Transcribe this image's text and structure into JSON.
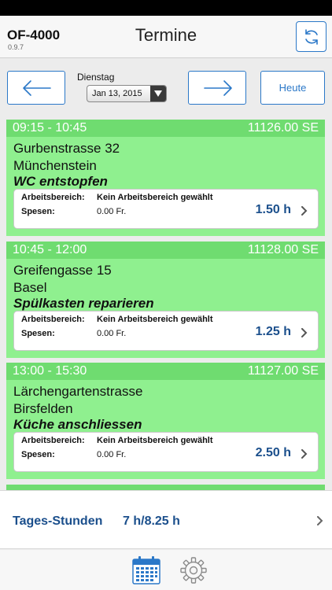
{
  "app": {
    "name": "OF-4000",
    "version": "0.9.7"
  },
  "nav": {
    "title": "Termine"
  },
  "datebar": {
    "day_label": "Dienstag",
    "date_value": "Jan 13, 2015",
    "today_label": "Heute"
  },
  "appointments": [
    {
      "time": "09:15 - 10:45",
      "number": "11126.00 SE",
      "street": "Gurbenstrasse 32",
      "city": "Münchenstein",
      "task": "WC entstopfen",
      "area_label": "Arbeitsbereich:",
      "area_value": "Kein Arbeitsbereich gewählt",
      "spesen_label": "Spesen:",
      "spesen_value": "0.00 Fr.",
      "hours": "1.50 h"
    },
    {
      "time": "10:45 - 12:00",
      "number": "11128.00 SE",
      "street": "Greifengasse 15",
      "city": "Basel",
      "task": "Spülkasten reparieren",
      "area_label": "Arbeitsbereich:",
      "area_value": "Kein Arbeitsbereich gewählt",
      "spesen_label": "Spesen:",
      "spesen_value": "0.00 Fr.",
      "hours": "1.25 h"
    },
    {
      "time": "13:00 - 15:30",
      "number": "11127.00 SE",
      "street": "Lärchengartenstrasse",
      "city": "Birsfelden",
      "task": "Küche anschliessen",
      "area_label": "Arbeitsbereich:",
      "area_value": "Kein Arbeitsbereich gewählt",
      "spesen_label": "Spesen:",
      "spesen_value": "0.00 Fr.",
      "hours": "2.50 h"
    }
  ],
  "totals": {
    "label": "Tages-Stunden",
    "value": "7 h/8.25 h"
  },
  "icons": {
    "sync": "sync-icon",
    "prev": "arrow-left-icon",
    "next": "arrow-right-icon",
    "dropdown": "triangle-down-icon",
    "chevron": "chevron-right-icon",
    "calendar": "calendar-icon",
    "settings": "gear-icon"
  },
  "colors": {
    "accent": "#2b78c8",
    "card": "#8ff08f",
    "card_header": "#6fdc70",
    "hours_text": "#1b4f8c"
  }
}
